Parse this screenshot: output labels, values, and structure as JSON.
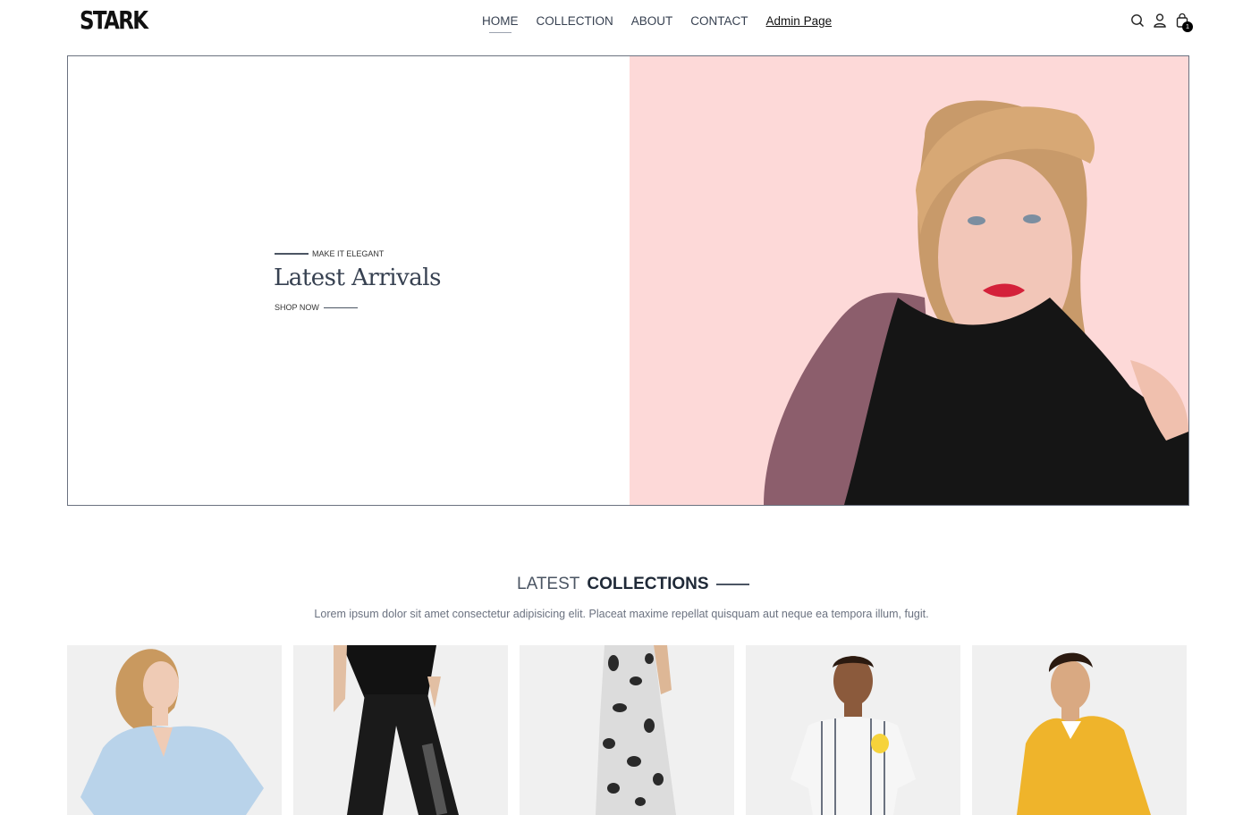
{
  "header": {
    "logo": "STARK",
    "nav": [
      "HOME",
      "COLLECTION",
      "ABOUT",
      "CONTACT"
    ],
    "admin_link": "Admin Page",
    "cart_count": "1",
    "icons": [
      "search-icon",
      "user-icon",
      "cart-icon"
    ]
  },
  "hero": {
    "kicker": "MAKE IT ELEGANT",
    "title": "Latest Arrivals",
    "cta": "SHOP NOW",
    "image_background": "#fdd9d8"
  },
  "collections": {
    "title_light": "LATEST ",
    "title_bold": "COLLECTIONS",
    "description": "Lorem ipsum dolor sit amet consectetur adipisicing elit. Placeat maxime repellat quisquam aut neque ea tempora illum, fugit.",
    "products": [
      {
        "name": "product-blouse"
      },
      {
        "name": "product-track-pants"
      },
      {
        "name": "product-print-dress"
      },
      {
        "name": "product-kids-shirt"
      },
      {
        "name": "product-yellow-jacket"
      }
    ]
  }
}
